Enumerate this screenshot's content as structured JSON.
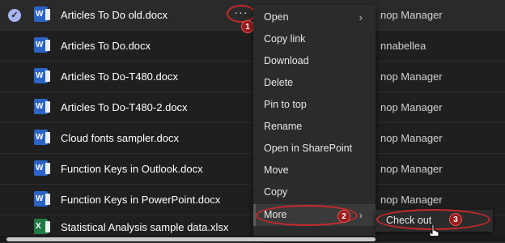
{
  "files": [
    {
      "name": "Articles To Do old.docx",
      "type": "word",
      "modified_by": "nop Manager",
      "selected": true
    },
    {
      "name": "Articles To Do.docx",
      "type": "word",
      "modified_by": "nnabellea",
      "selected": false
    },
    {
      "name": "Articles To Do-T480.docx",
      "type": "word",
      "modified_by": "nop Manager",
      "selected": false
    },
    {
      "name": "Articles To Do-T480-2.docx",
      "type": "word",
      "modified_by": "nop Manager",
      "selected": false
    },
    {
      "name": "Cloud fonts sampler.docx",
      "type": "word",
      "modified_by": "nop Manager",
      "selected": false
    },
    {
      "name": "Function Keys in Outlook.docx",
      "type": "word",
      "modified_by": "nop Manager",
      "selected": false
    },
    {
      "name": "Function Keys in PowerPoint.docx",
      "type": "word",
      "modified_by": "nop Manager",
      "selected": false
    },
    {
      "name": "Statistical Analysis sample data.xlsx",
      "type": "excel",
      "modified_by": "",
      "selected": false
    }
  ],
  "file_icons": {
    "word": "W",
    "excel": "X"
  },
  "more_button": {
    "label": "···",
    "icon": "more-horizontal-icon"
  },
  "context_menu": {
    "items": [
      {
        "label": "Open",
        "has_submenu": true
      },
      {
        "label": "Copy link",
        "has_submenu": false
      },
      {
        "label": "Download",
        "has_submenu": false
      },
      {
        "label": "Delete",
        "has_submenu": false
      },
      {
        "label": "Pin to top",
        "has_submenu": false
      },
      {
        "label": "Rename",
        "has_submenu": false
      },
      {
        "label": "Open in SharePoint",
        "has_submenu": false
      },
      {
        "label": "Move",
        "has_submenu": false
      },
      {
        "label": "Copy",
        "has_submenu": false
      },
      {
        "label": "More",
        "has_submenu": true
      }
    ],
    "chevron": "›"
  },
  "submenu": {
    "items": [
      {
        "label": "Check out"
      }
    ]
  },
  "annotations": {
    "step1": "1",
    "step2": "2",
    "step3": "3"
  },
  "selected_check": "✓",
  "colors": {
    "accent": "#a8b4f0",
    "annotation": "#c8282a",
    "word": "#2b63c6",
    "excel": "#1f7a45",
    "background": "#1f1f1f"
  }
}
